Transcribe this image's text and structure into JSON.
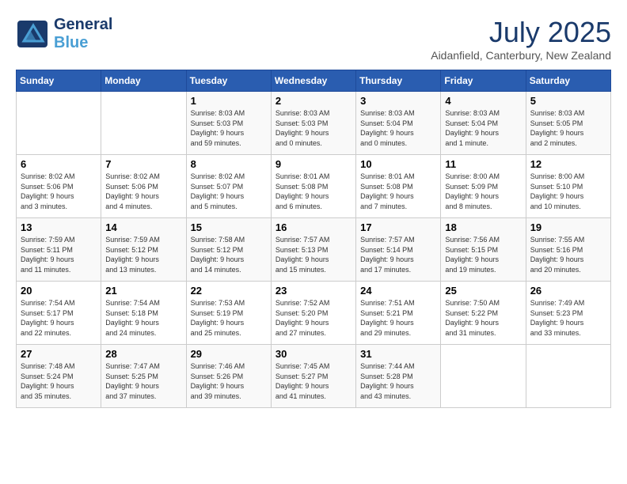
{
  "logo": {
    "line1": "General",
    "line2": "Blue",
    "icon": "▶"
  },
  "header": {
    "month_year": "July 2025",
    "location": "Aidanfield, Canterbury, New Zealand"
  },
  "days_of_week": [
    "Sunday",
    "Monday",
    "Tuesday",
    "Wednesday",
    "Thursday",
    "Friday",
    "Saturday"
  ],
  "weeks": [
    [
      {
        "day": "",
        "info": ""
      },
      {
        "day": "",
        "info": ""
      },
      {
        "day": "1",
        "info": "Sunrise: 8:03 AM\nSunset: 5:03 PM\nDaylight: 9 hours\nand 59 minutes."
      },
      {
        "day": "2",
        "info": "Sunrise: 8:03 AM\nSunset: 5:03 PM\nDaylight: 9 hours\nand 0 minutes."
      },
      {
        "day": "3",
        "info": "Sunrise: 8:03 AM\nSunset: 5:04 PM\nDaylight: 9 hours\nand 0 minutes."
      },
      {
        "day": "4",
        "info": "Sunrise: 8:03 AM\nSunset: 5:04 PM\nDaylight: 9 hours\nand 1 minute."
      },
      {
        "day": "5",
        "info": "Sunrise: 8:03 AM\nSunset: 5:05 PM\nDaylight: 9 hours\nand 2 minutes."
      }
    ],
    [
      {
        "day": "6",
        "info": "Sunrise: 8:02 AM\nSunset: 5:06 PM\nDaylight: 9 hours\nand 3 minutes."
      },
      {
        "day": "7",
        "info": "Sunrise: 8:02 AM\nSunset: 5:06 PM\nDaylight: 9 hours\nand 4 minutes."
      },
      {
        "day": "8",
        "info": "Sunrise: 8:02 AM\nSunset: 5:07 PM\nDaylight: 9 hours\nand 5 minutes."
      },
      {
        "day": "9",
        "info": "Sunrise: 8:01 AM\nSunset: 5:08 PM\nDaylight: 9 hours\nand 6 minutes."
      },
      {
        "day": "10",
        "info": "Sunrise: 8:01 AM\nSunset: 5:08 PM\nDaylight: 9 hours\nand 7 minutes."
      },
      {
        "day": "11",
        "info": "Sunrise: 8:00 AM\nSunset: 5:09 PM\nDaylight: 9 hours\nand 8 minutes."
      },
      {
        "day": "12",
        "info": "Sunrise: 8:00 AM\nSunset: 5:10 PM\nDaylight: 9 hours\nand 10 minutes."
      }
    ],
    [
      {
        "day": "13",
        "info": "Sunrise: 7:59 AM\nSunset: 5:11 PM\nDaylight: 9 hours\nand 11 minutes."
      },
      {
        "day": "14",
        "info": "Sunrise: 7:59 AM\nSunset: 5:12 PM\nDaylight: 9 hours\nand 13 minutes."
      },
      {
        "day": "15",
        "info": "Sunrise: 7:58 AM\nSunset: 5:12 PM\nDaylight: 9 hours\nand 14 minutes."
      },
      {
        "day": "16",
        "info": "Sunrise: 7:57 AM\nSunset: 5:13 PM\nDaylight: 9 hours\nand 15 minutes."
      },
      {
        "day": "17",
        "info": "Sunrise: 7:57 AM\nSunset: 5:14 PM\nDaylight: 9 hours\nand 17 minutes."
      },
      {
        "day": "18",
        "info": "Sunrise: 7:56 AM\nSunset: 5:15 PM\nDaylight: 9 hours\nand 19 minutes."
      },
      {
        "day": "19",
        "info": "Sunrise: 7:55 AM\nSunset: 5:16 PM\nDaylight: 9 hours\nand 20 minutes."
      }
    ],
    [
      {
        "day": "20",
        "info": "Sunrise: 7:54 AM\nSunset: 5:17 PM\nDaylight: 9 hours\nand 22 minutes."
      },
      {
        "day": "21",
        "info": "Sunrise: 7:54 AM\nSunset: 5:18 PM\nDaylight: 9 hours\nand 24 minutes."
      },
      {
        "day": "22",
        "info": "Sunrise: 7:53 AM\nSunset: 5:19 PM\nDaylight: 9 hours\nand 25 minutes."
      },
      {
        "day": "23",
        "info": "Sunrise: 7:52 AM\nSunset: 5:20 PM\nDaylight: 9 hours\nand 27 minutes."
      },
      {
        "day": "24",
        "info": "Sunrise: 7:51 AM\nSunset: 5:21 PM\nDaylight: 9 hours\nand 29 minutes."
      },
      {
        "day": "25",
        "info": "Sunrise: 7:50 AM\nSunset: 5:22 PM\nDaylight: 9 hours\nand 31 minutes."
      },
      {
        "day": "26",
        "info": "Sunrise: 7:49 AM\nSunset: 5:23 PM\nDaylight: 9 hours\nand 33 minutes."
      }
    ],
    [
      {
        "day": "27",
        "info": "Sunrise: 7:48 AM\nSunset: 5:24 PM\nDaylight: 9 hours\nand 35 minutes."
      },
      {
        "day": "28",
        "info": "Sunrise: 7:47 AM\nSunset: 5:25 PM\nDaylight: 9 hours\nand 37 minutes."
      },
      {
        "day": "29",
        "info": "Sunrise: 7:46 AM\nSunset: 5:26 PM\nDaylight: 9 hours\nand 39 minutes."
      },
      {
        "day": "30",
        "info": "Sunrise: 7:45 AM\nSunset: 5:27 PM\nDaylight: 9 hours\nand 41 minutes."
      },
      {
        "day": "31",
        "info": "Sunrise: 7:44 AM\nSunset: 5:28 PM\nDaylight: 9 hours\nand 43 minutes."
      },
      {
        "day": "",
        "info": ""
      },
      {
        "day": "",
        "info": ""
      }
    ]
  ]
}
